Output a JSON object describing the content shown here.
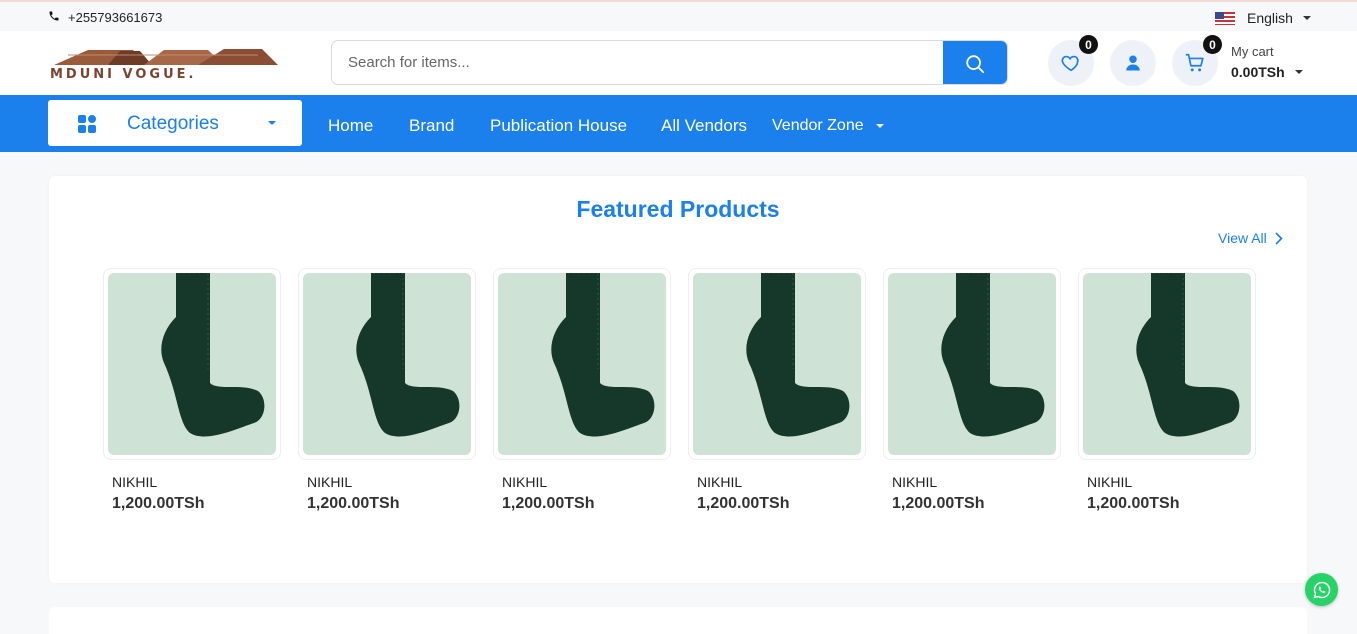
{
  "topbar": {
    "phone": "+255793661673",
    "language": "English"
  },
  "header": {
    "logo_text": "MDUNI VOGUE.",
    "search_placeholder": "Search for items...",
    "wishlist_count": "0",
    "cart_count": "0",
    "cart_label": "My cart",
    "cart_total": "0.00TSh"
  },
  "nav": {
    "categories_label": "Categories",
    "links": [
      "Home",
      "Brand",
      "Publication House",
      "All Vendors"
    ],
    "vendor_zone": "Vendor Zone"
  },
  "featured": {
    "title": "Featured Products",
    "view_all": "View All",
    "products": [
      {
        "name": "NIKHIL",
        "price": "1,200.00TSh"
      },
      {
        "name": "NIKHIL",
        "price": "1,200.00TSh"
      },
      {
        "name": "NIKHIL",
        "price": "1,200.00TSh"
      },
      {
        "name": "NIKHIL",
        "price": "1,200.00TSh"
      },
      {
        "name": "NIKHIL",
        "price": "1,200.00TSh"
      },
      {
        "name": "NIKHIL",
        "price": "1,200.00TSh"
      }
    ]
  },
  "colors": {
    "primary": "#1b7fec",
    "whatsapp": "#25d366"
  }
}
